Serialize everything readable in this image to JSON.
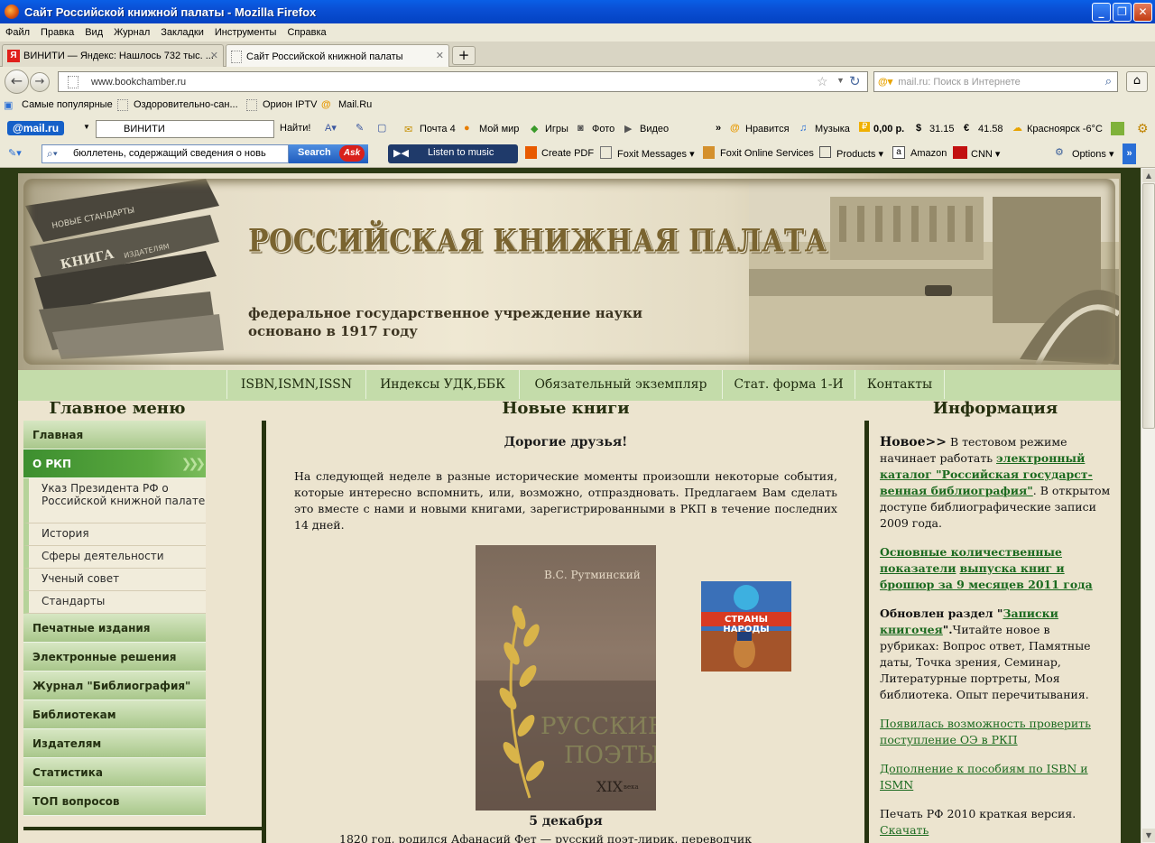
{
  "window": {
    "title": "Сайт Российской книжной палаты - Mozilla Firefox",
    "minimize": "_",
    "maximize": "❐",
    "close": "✕"
  },
  "menubar": [
    "Файл",
    "Правка",
    "Вид",
    "Журнал",
    "Закладки",
    "Инструменты",
    "Справка"
  ],
  "tabs": [
    {
      "label": "ВИНИТИ — Яндекс: Нашлось 732 тыс. ...",
      "active": false
    },
    {
      "label": "Сайт Российской книжной палаты",
      "active": true
    }
  ],
  "nav": {
    "url": "www.bookchamber.ru",
    "search_placeholder": "mail.ru: Поиск в Интернете"
  },
  "bookmarks": [
    "Самые популярные",
    "Оздоровительно-сан...",
    "Орион IPTV",
    "Mail.Ru"
  ],
  "mailru_toolbar": {
    "logo": "@mail.ru",
    "query": "ВИНИТИ",
    "find": "Найти!",
    "items": [
      "Почта 4",
      "Мой мир",
      "Игры",
      "Фото",
      "Видео",
      "Нравится",
      "Музыка",
      "0,00 р.",
      "31.15",
      "41.58",
      "Красноярск -6°C"
    ],
    "more": "»"
  },
  "ask_toolbar": {
    "query": "бюллетень, содержащий сведения о новь",
    "search": "Search",
    "music": "Listen to music",
    "items": [
      "Create PDF",
      "Foxit Messages ▾",
      "Foxit Online Services",
      "Products ▾",
      "Amazon",
      "CNN ▾",
      "Options ▾"
    ]
  },
  "site": {
    "title": "РОССИЙСКАЯ КНИЖНАЯ ПАЛАТА",
    "subtitle1": "федеральное государственное учреждение науки",
    "subtitle2": "основано в 1917 году",
    "book_spines": [
      "НОВЫЕ СТАНДАРТЫ",
      "КНИГА",
      "ИЗДАТЕЛЯМ"
    ],
    "topnav": [
      "ISBN,ISMN,ISSN",
      "Индексы УДК,ББК",
      "Обязательный экземпляр",
      "Стат. форма 1-И",
      "Контакты"
    ],
    "left_title": "Главное меню",
    "center_title": "Новые книги",
    "right_title": "Информация",
    "menu": {
      "main": "Главная",
      "rkp": "О РКП",
      "rkp_sub": [
        "Указ Президента РФ о Российской книжной палате",
        "История",
        "Сферы деятельности",
        "Ученый совет",
        "Стандарты"
      ],
      "rest": [
        "Печатные издания",
        "Электронные решения",
        "Журнал \"Библиография\"",
        "Библиотекам",
        "Издателям",
        "Статистика",
        "ТОП вопросов"
      ]
    },
    "greeting": "Дорогие друзья!",
    "intro": "На следующей неделе в разные исторические моменты произошли некоторые события, которые интересно вспомнить, или, возможно, отпраздновать. Предлагаем Вам сделать это вместе с нами и новыми книгами, зарегистрированными в РКП в течение последних 14 дней.",
    "book1": {
      "author": "В.С. Рутминский",
      "title1": "РУССКИЕ",
      "title2": "ПОЭТЫ",
      "title3": "XIX",
      "title4": "века"
    },
    "book2": {
      "title": "СТРАНЫ НАРОДЫ"
    },
    "date": "5 декабря",
    "date_text": "1820 год, родился Афанасий Фет — русский поэт-лирик, переводчик",
    "info": {
      "new_label": "Новое>>",
      "new_text1": " В тестовом режиме начинает работать ",
      "new_link": "электронный каталог \"Российская государст-венная библиография\"",
      "new_text2": ". В открытом доступе библиографические записи 2009 года.",
      "stats_link1": "Основные количественные показатели",
      "stats_link2": "выпуска книг и брошюр за 9 месяцев 2011 года",
      "upd_label": "Обновлен раздел \"",
      "upd_link": "Записки книгочея",
      "upd_tail": "\".",
      "upd_text": "Читайте новое в рубриках: Вопрос ответ, Памятные даты, Точка зрения, Семинар, Литературные портреты, Моя библиотека. Опыт перечитывания.",
      "link_oe": "Появилась возможность проверить поступление ОЭ в РКП",
      "link_isbn": "Дополнение к пособиям по ISBN и ISMN",
      "print_text": "Печать РФ 2010 краткая версия.",
      "download": "Скачать"
    }
  }
}
